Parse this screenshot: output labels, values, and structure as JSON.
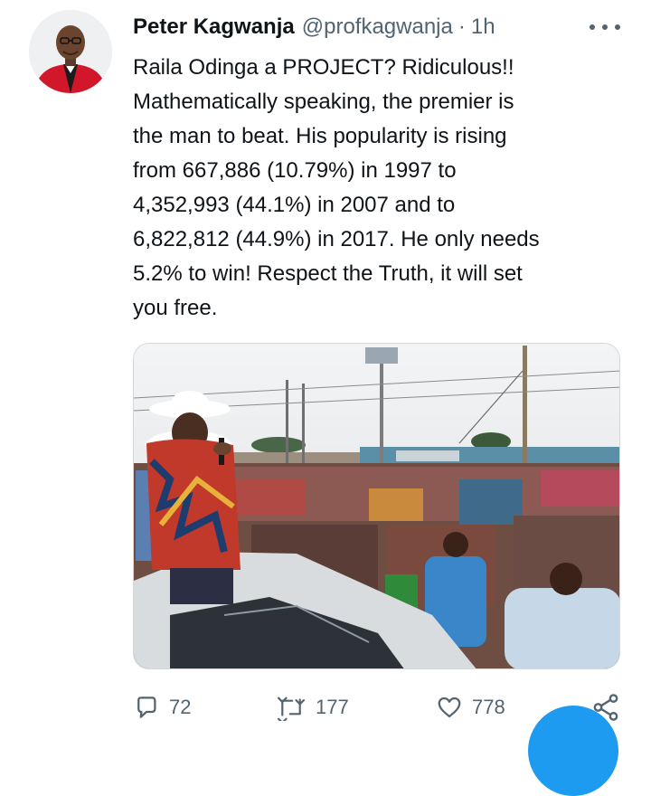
{
  "author": {
    "name": "Peter Kagwanja",
    "handle": "@profkagwanja",
    "separator": "·",
    "time": "1h"
  },
  "tweet": {
    "text": "Raila Odinga a PROJECT? Ridiculous!!\nMathematically speaking, the premier is\nthe man to beat. His popularity is rising\nfrom 667,886 (10.79%) in 1997 to\n4,352,993 (44.1%) in 2007 and to\n6,822,812 (44.9%) in 2017. He only needs\n5.2% to win! Respect the Truth, it will set\nyou free."
  },
  "actions": {
    "replies": "72",
    "retweets": "177",
    "likes": "778"
  },
  "icons": {
    "more": "more-dots-icon",
    "reply": "reply-icon",
    "retweet": "retweet-icon",
    "like": "heart-icon",
    "share": "share-icon"
  },
  "colors": {
    "text": "#0f1419",
    "secondary": "#536471",
    "accent": "#1d9bf0",
    "border": "#cfd9de"
  }
}
